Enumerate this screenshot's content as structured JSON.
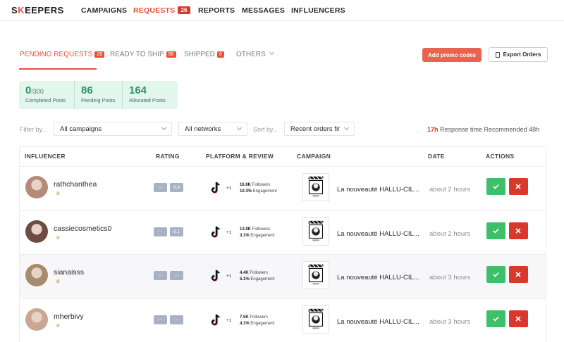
{
  "nav": {
    "logo_prefix": "S",
    "logo_k": "K",
    "logo_suffix": "EEPERS",
    "items": [
      {
        "label": "CAMPAIGNS"
      },
      {
        "label": "REQUESTS",
        "badge": "26"
      },
      {
        "label": "REPORTS"
      },
      {
        "label": "MESSAGES"
      },
      {
        "label": "INFLUENCERS"
      }
    ]
  },
  "tabs": [
    {
      "label": "PENDING REQUESTS",
      "badge": "26"
    },
    {
      "label": "READY TO SHIP",
      "badge": "86"
    },
    {
      "label": "SHIPPED",
      "badge": "0"
    },
    {
      "label": "OTHERS"
    }
  ],
  "actions": {
    "promo": "Add promo codes",
    "export": "Export Orders"
  },
  "stats": [
    {
      "num": "0",
      "suffix": "/300",
      "label": "Completed Posts"
    },
    {
      "num": "86",
      "label": "Pending Posts"
    },
    {
      "num": "164",
      "label": "Allocated Posts"
    }
  ],
  "filters": {
    "filter_label": "Filter by...",
    "campaign": "All campaigns",
    "network": "All networks",
    "sort_label": "Sort by...",
    "sort": "Recent orders fir"
  },
  "response": {
    "value": "17h",
    "text": " Response time Recommended 48h"
  },
  "table": {
    "headers": {
      "influencer": "INFLUENCER",
      "rating": "RATING",
      "platform": "PLATFORM & REVIEW",
      "campaign": "CAMPAIGN",
      "date": "DATE",
      "actions": "ACTIONS"
    },
    "rows": [
      {
        "name": "rathchanthea",
        "rating": [
          "--",
          "8.8"
        ],
        "plus": "+1",
        "followers": "16.6K",
        "followers_label": " Followers",
        "engagement": "10.3%",
        "engagement_label": " Engagement",
        "campaign": "La nouveauté HALLU-CIL...",
        "date": "about 2 hours"
      },
      {
        "name": "cassiecosmetics0",
        "rating": [
          "--",
          "8.1"
        ],
        "plus": "+1",
        "followers": "13.9K",
        "followers_label": " Followers",
        "engagement": "3.1%",
        "engagement_label": " Engagement",
        "campaign": "La nouveauté HALLU-CIL...",
        "date": "about 2 hours"
      },
      {
        "name": "sianaisss",
        "rating": [
          "--",
          "--"
        ],
        "plus": "+1",
        "followers": "4.4K",
        "followers_label": " Followers",
        "engagement": "5.1%",
        "engagement_label": " Engagement",
        "campaign": "La nouveauté HALLU-CIL...",
        "date": "about 3 hours"
      },
      {
        "name": "mherbivy",
        "rating": [
          "--",
          "--"
        ],
        "plus": "+1",
        "followers": "7.5K",
        "followers_label": " Followers",
        "engagement": "4.1%",
        "engagement_label": " Engagement",
        "campaign": "La nouveauté HALLU-CIL...",
        "date": "about 3 hours"
      }
    ]
  },
  "colors": {
    "accent": "#e8503a",
    "success": "#3ec06a",
    "danger": "#d9382d",
    "stat_bg": "#e3f6ee"
  }
}
